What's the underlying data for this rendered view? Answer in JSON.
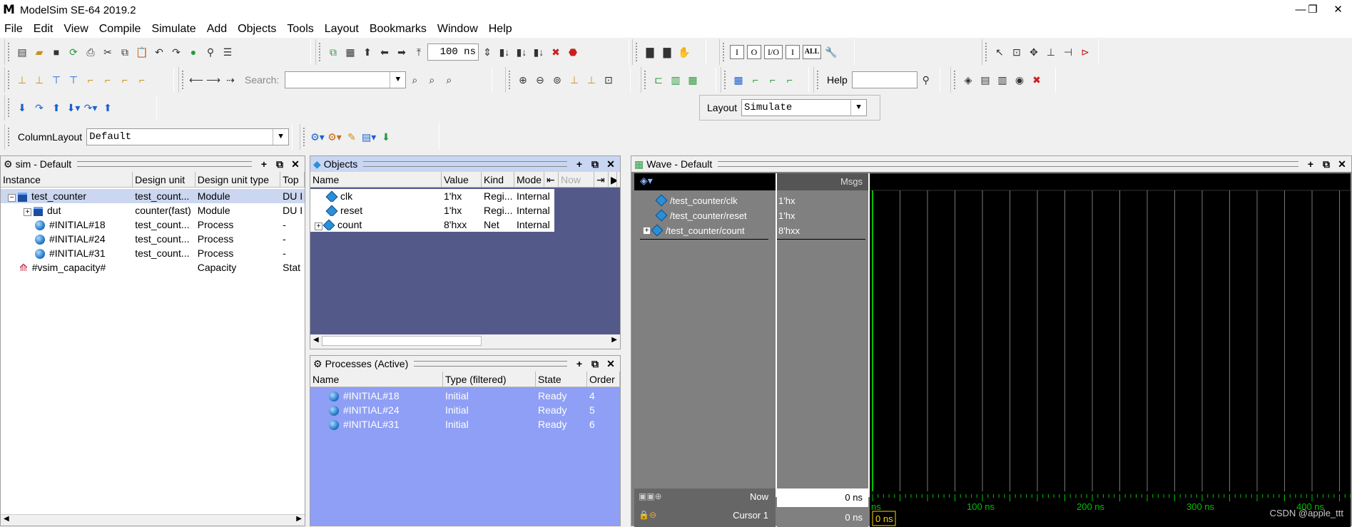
{
  "window": {
    "title": "ModelSim SE-64 2019.2",
    "logo": "M",
    "controls": [
      "—",
      "❐",
      "✕"
    ]
  },
  "menu": [
    "File",
    "Edit",
    "View",
    "Compile",
    "Simulate",
    "Add",
    "Objects",
    "Tools",
    "Layout",
    "Bookmarks",
    "Window",
    "Help"
  ],
  "toolbar": {
    "run_length": "100 ns",
    "search_label": "Search:",
    "search_value": "",
    "help_label": "Help",
    "help_value": "",
    "layout_label": "Layout",
    "layout_value": "Simulate",
    "columnlayout_label": "ColumnLayout",
    "columnlayout_value": "Default",
    "box_buttons": [
      "I",
      "O",
      "I/O",
      "I",
      "ALL"
    ]
  },
  "sim": {
    "title": "sim - Default",
    "columns": [
      "Instance",
      "Design unit",
      "Design unit type",
      "Top"
    ],
    "rows": [
      {
        "instance": "test_counter",
        "unit": "test_count...",
        "type": "Module",
        "top": "DU I",
        "icon": "module-icon",
        "expander": "−"
      },
      {
        "instance": "dut",
        "unit": "counter(fast)",
        "type": "Module",
        "top": "DU I",
        "icon": "module-icon",
        "expander": "+"
      },
      {
        "instance": "#INITIAL#18",
        "unit": "test_count...",
        "type": "Process",
        "top": "-",
        "icon": "process-icon"
      },
      {
        "instance": "#INITIAL#24",
        "unit": "test_count...",
        "type": "Process",
        "top": "-",
        "icon": "process-icon"
      },
      {
        "instance": "#INITIAL#31",
        "unit": "test_count...",
        "type": "Process",
        "top": "-",
        "icon": "process-icon"
      },
      {
        "instance": "#vsim_capacity#",
        "unit": "",
        "type": "Capacity",
        "top": "Stat",
        "icon": "capacity-icon"
      }
    ]
  },
  "objects": {
    "title": "Objects",
    "columns": [
      "Name",
      "Value",
      "Kind",
      "Mode"
    ],
    "now_label": "Now",
    "rows": [
      {
        "name": "clk",
        "value": "1'hx",
        "kind": "Regi...",
        "mode": "Internal"
      },
      {
        "name": "reset",
        "value": "1'hx",
        "kind": "Regi...",
        "mode": "Internal"
      },
      {
        "name": "count",
        "value": "8'hxx",
        "kind": "Net",
        "mode": "Internal",
        "expander": "+"
      }
    ]
  },
  "processes": {
    "title": "Processes (Active)",
    "columns": [
      "Name",
      "Type (filtered)",
      "State",
      "Order"
    ],
    "rows": [
      {
        "name": "#INITIAL#18",
        "type": "Initial",
        "state": "Ready",
        "order": "4"
      },
      {
        "name": "#INITIAL#24",
        "type": "Initial",
        "state": "Ready",
        "order": "5"
      },
      {
        "name": "#INITIAL#31",
        "type": "Initial",
        "state": "Ready",
        "order": "6"
      }
    ]
  },
  "wave": {
    "title": "Wave - Default",
    "msgs_label": "Msgs",
    "signals": [
      {
        "name": "/test_counter/clk",
        "value": "1'hx"
      },
      {
        "name": "/test_counter/reset",
        "value": "1'hx"
      },
      {
        "name": "/test_counter/count",
        "value": "8'hxx",
        "expander": "+"
      }
    ],
    "now_label": "Now",
    "now_value": "0 ns",
    "cursor_label": "Cursor 1",
    "cursor_value": "0 ns",
    "cursor_marker": "0 ns",
    "timeline_labels": [
      "ns",
      "100 ns",
      "200 ns",
      "300 ns",
      "400 ns"
    ]
  },
  "watermark": "CSDN @apple_ttt",
  "colors": {
    "objects_bg": "#535a8a",
    "processes_bg": "#8f9ff5",
    "wave_bg": "#000000",
    "wave_names_bg": "#808080",
    "timeline_green": "#00c000",
    "cursor_yellow": "#ffd400"
  }
}
